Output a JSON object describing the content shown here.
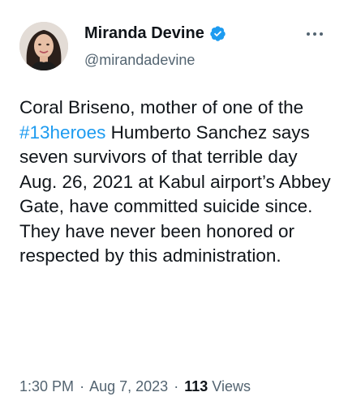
{
  "author": {
    "display_name": "Miranda Devine",
    "handle": "@mirandadevine",
    "verified": true
  },
  "colors": {
    "link": "#1d9bf0",
    "text": "#0f1419",
    "secondary": "#536471"
  },
  "icons": {
    "verified": "verified-badge-icon",
    "more": "more-options-icon"
  },
  "tweet": {
    "text_before": "Coral Briseno, mother of one of the ",
    "hashtag": "#13heroes",
    "text_after": " Humberto Sanchez says seven survivors of that terrible day Aug. 26, 2021 at Kabul airport’s Abbey Gate, have committed suicide since. They have never been honored or respected by this administration."
  },
  "meta": {
    "time": "1:30 PM",
    "date": "Aug 7, 2023",
    "views_count": "113",
    "views_label": "Views",
    "separator": "·"
  }
}
